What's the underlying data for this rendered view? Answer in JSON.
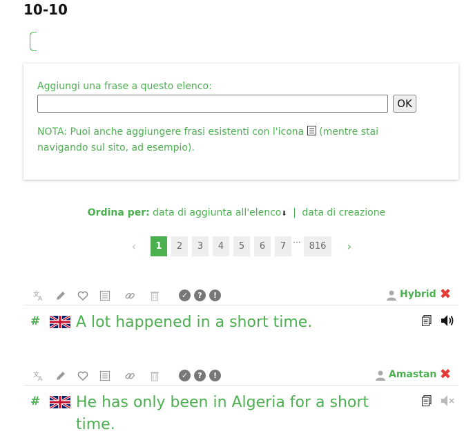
{
  "page": {
    "title": "10-10"
  },
  "add_panel": {
    "label": "Aggiungi una frase a questo elenco:",
    "input_value": "",
    "ok_label": "OK",
    "note_before": "NOTA: Puoi anche aggiungere frasi esistenti con l'icona",
    "note_after": "(mentre stai navigando sul sito, ad esempio)."
  },
  "sort": {
    "label": "Ordina per:",
    "option_added": "data di aggiunta all'elenco",
    "option_added_arrow": "⬇",
    "separator": "|",
    "option_created": "data di creazione"
  },
  "pagination": {
    "prev": "‹",
    "pages": [
      "1",
      "2",
      "3",
      "4",
      "5",
      "6",
      "7"
    ],
    "active": "1",
    "ellipsis": "···",
    "last": "816",
    "next": "›"
  },
  "sentences": [
    {
      "owner": "Hybrid",
      "hash": "#",
      "language": "English",
      "text_line1": "A lot happened in a short time.",
      "text_line2": "",
      "audio": "available"
    },
    {
      "owner": "Amastan",
      "hash": "#",
      "language": "English",
      "text_line1": "He has only been in Algeria for a short",
      "text_line2": "time.",
      "audio": "unavailable"
    }
  ],
  "colors": {
    "accent": "#4caf50",
    "remove": "#e53935",
    "muted": "#999999"
  },
  "icons": {
    "tools": [
      "translate-icon",
      "edit-icon",
      "favorite-icon",
      "add-to-list-icon",
      "link-icon",
      "delete-icon"
    ],
    "review": [
      "review-ok-icon",
      "review-unsure-icon",
      "review-not-ok-icon"
    ]
  }
}
